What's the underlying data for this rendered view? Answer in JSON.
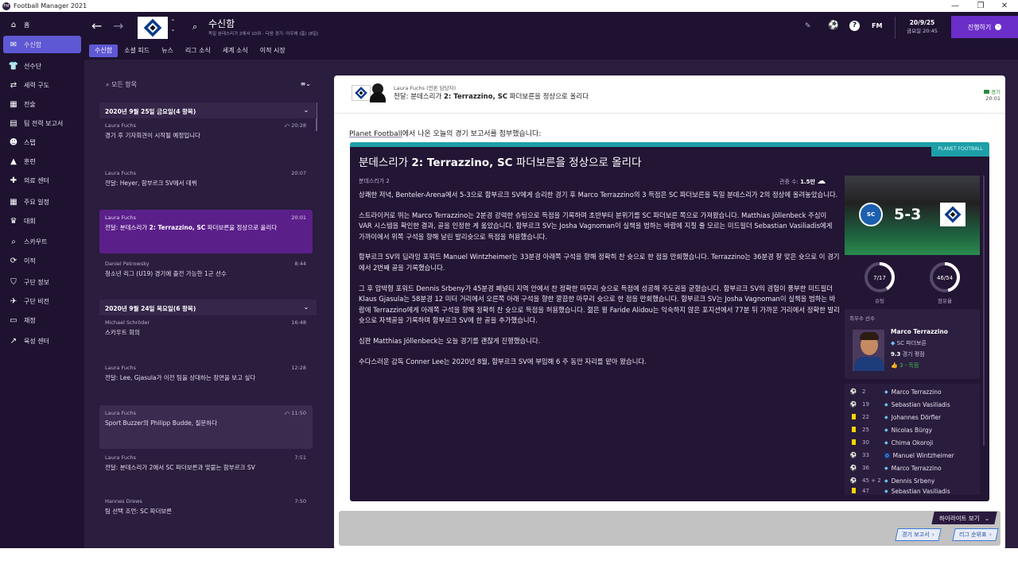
{
  "window": {
    "title": "Football Manager 2021",
    "minimize": "—",
    "restore": "❐",
    "close": "✕"
  },
  "sidebar": {
    "items": [
      {
        "label": "홈",
        "icon": "home-icon",
        "glyph": "⌂"
      },
      {
        "label": "수신함",
        "icon": "inbox-icon",
        "glyph": "✉",
        "active": true
      },
      {
        "label": "선수단",
        "icon": "squad-icon",
        "glyph": "👕"
      },
      {
        "label": "세력 구도",
        "icon": "dynamics-icon",
        "glyph": "⇄"
      },
      {
        "label": "전술",
        "icon": "tactics-icon",
        "glyph": "▦"
      },
      {
        "label": "팀 전력 보고서",
        "icon": "report-icon",
        "glyph": "▤"
      },
      {
        "label": "스탭",
        "icon": "staff-icon",
        "glyph": "☻"
      },
      {
        "label": "훈련",
        "icon": "training-icon",
        "glyph": "▲"
      },
      {
        "label": "의료 센터",
        "icon": "medical-icon",
        "glyph": "✚"
      },
      {
        "label": "주요 일정",
        "icon": "calendar-icon",
        "glyph": "▦"
      },
      {
        "label": "대회",
        "icon": "trophy-icon",
        "glyph": "♛"
      },
      {
        "label": "스카우트",
        "icon": "scout-icon",
        "glyph": "⌕"
      },
      {
        "label": "이적",
        "icon": "transfer-icon",
        "glyph": "⟳"
      },
      {
        "label": "구단 정보",
        "icon": "club-info-icon",
        "glyph": "⛉"
      },
      {
        "label": "구단 비전",
        "icon": "vision-icon",
        "glyph": "✈"
      },
      {
        "label": "재정",
        "icon": "finance-icon",
        "glyph": "▭"
      },
      {
        "label": "육성 센터",
        "icon": "development-icon",
        "glyph": "↗"
      }
    ]
  },
  "topbar": {
    "title": "수신함",
    "subtitle": "독일 분데스리가 2에서 10위 - 다음 경기: 아우에 (홈) (8일)",
    "date": "20/9/25",
    "datetime": "금요일 20:45",
    "fm_label": "FM",
    "continue_label": "진행하기",
    "help_glyph": "?"
  },
  "tabs": [
    "수신함",
    "소셜 피드",
    "뉴스",
    "리그 소식",
    "세계 소식",
    "이적 시장"
  ],
  "inbox": {
    "search_placeholder": "모든 항목",
    "groups": [
      {
        "header": "2020년 9월 25일 금요일(4 항목)"
      },
      {
        "header": "2020년 9월 24일 목요일(6 항목)"
      }
    ],
    "messages": [
      {
        "sender": "Laura Fuchs",
        "time": "20:28",
        "subject": "경기 후 기자회견이 시작될 예정입니다"
      },
      {
        "sender": "Laura Fuchs",
        "time": "20:07",
        "subject": "전달: Heyer, 함부르크 SV에서 데뷔"
      },
      {
        "sender": "Laura Fuchs",
        "time": "20:01",
        "subject_pre": "전달: 분데스리가 ",
        "subject_bold": "2: Terrazzino, SC",
        "subject_post": " 파더보른을 정상으로 올리다"
      },
      {
        "sender": "Daniel Petrowsky",
        "time": "8:44",
        "subject": "청소년 리그 (U19) 경기에 출전 가능한 1군 선수"
      },
      {
        "sender": "Michael Schröder",
        "time": "16:48",
        "subject": "스카우트 회의"
      },
      {
        "sender": "Laura Fuchs",
        "time": "12:28",
        "subject": "전달: Lee, Gjasula가 이전 팀을 상대하는 장면을 보고 싶다"
      },
      {
        "sender": "Laura Fuchs",
        "time": "11:50",
        "subject": "Sport Buzzer의 Philipp Budde, 질문하다"
      },
      {
        "sender": "Laura Fuchs",
        "time": "7:51",
        "subject": "전달: 분데스리가 2에서 SC 파더보른과 맞붙는 함부르크 SV"
      },
      {
        "sender": "Hannes Drews",
        "time": "7:50",
        "subject": "팀 선택 조언: SC 파더보른"
      }
    ]
  },
  "detail": {
    "from": "Laura Fuchs (언론 담당자)",
    "subject_pre": "전달: 분데스리가 ",
    "subject_bold": "2: Terrazzino, SC",
    "subject_post": " 파더보른을 정상으로 올리다",
    "tag": "경기",
    "time": "20:01",
    "intro_link": "Planet Football",
    "intro_rest": "에서 나온 오늘의 경기 보고서를 첨부했습니다:",
    "article": {
      "badge": "PLANET FOOTBALL",
      "title_pre": "분데스리가 ",
      "title_bold": "2: Terrazzino, SC",
      "title_post": " 파더보른을 정상으로 올리다",
      "competition": "분데스리가 2",
      "attendance_label": "관중 수:",
      "attendance_value": "1.5만",
      "p1": "상쾌한 저녁, Benteler-Arena에서 5-3으로 함부르크 SV에게 승리한 경기 후 Marco Terrazzino의 3 득점은 SC 파더보른을 독일 분데스리가 2의 정상에 올려놓았습니다.",
      "p2": "스트라이커로 뛰는 Marco Terrazzino는 2분경 강력한 슈팅으로 득점을 기록하며 초반부터 분위기를 SC 파더보른 쪽으로 가져왔습니다. Matthias Jöllenbeck 주심이 VAR 시스템을 확인한 결과, 골을 인정한 게 옳았습니다. 함부르크 SV는 Josha Vagnoman이 실책을 범하는 바람에 지칠 줄 모르는 미드필더 Sebastian Vasiliadis에게 가까이에서 위쪽 구석을 향해 날린 발리슛으로 득점을 허용했습니다.",
      "p3": "함부르크 SV의 딥라잉 포워드 Manuel Wintzheimer는 33분경 아래쪽 구석을 향해 정확히 찬 슛으로 한 점을 만회했습니다. Terrazzino는 36분경 잘 맞은 슛으로 이 경기에서 2번째 골을 기록했습니다.",
      "p4": "그 후 압박형 포워드 Dennis Srbeny가 45분경 페널티 지역 안에서 찬 정확한 마무리 슛으로 득점에 성공해 주도권을 굳혔습니다. 함부르크 SV의 경험이 풍부한 미드필더 Klaus Gjasula는 58분경 12 미터 거리에서 오른쪽 아래 구석을 향한 깔끔한 마무리 슛으로 한 점을 만회했습니다. 함부르크 SV는 Josha Vagnoman이 실책을 범하는 바람에 Terrazzino에게 아래쪽 구석을 향해 정확히 찬 슛으로 득점을 허용했습니다. 젊은 윙 Faride Alidou는 익숙하지 않은 포지션에서 77분 뒤 가까운 거리에서 정확한 발리슛으로 자책골을 기록하며 함부르크 SV에 한 골을 추가했습니다.",
      "p5": "심판 Matthias Jöllenbeck는 오늘 경기를 괜찮게 진행했습니다.",
      "p6": "수다스러운 감독 Conner Lee는 2020년 8월, 함부르크 SV에 부임해 6 주 동안 자리를 맡아 왔습니다."
    },
    "match": {
      "home_score": 5,
      "away_score": 3,
      "score_text": "5-3",
      "home_crest_text": "SC",
      "shots_value": "7/17",
      "shots_label": "슈팅",
      "shots_fraction": 0.41,
      "possession_value": "46/54",
      "possession_label": "점유율",
      "possession_fraction": 0.46,
      "motm_label": "최우수 선수",
      "motm_name": "Marco Terrazzino",
      "motm_club": "SC 파더보른",
      "motm_rating": "9.3",
      "motm_rating_label": "경기 평점",
      "motm_goals": "3 - 득점"
    },
    "events": [
      {
        "min": "2",
        "type": "goal",
        "player": "Marco Terrazzino"
      },
      {
        "min": "19",
        "type": "goal",
        "player": "Sebastian Vasiliadis"
      },
      {
        "min": "22",
        "type": "yellow",
        "player": "Johannes Dörfler"
      },
      {
        "min": "25",
        "type": "yellow",
        "player": "Nicolas Bürgy"
      },
      {
        "min": "30",
        "type": "yellow",
        "player": "Chima Okoroji"
      },
      {
        "min": "33",
        "type": "goal",
        "player": "Manuel Wintzheimer",
        "away": true
      },
      {
        "min": "36",
        "type": "goal",
        "player": "Marco Terrazzino"
      },
      {
        "min": "45 + 2",
        "type": "goal",
        "player": "Dennis Srbeny"
      },
      {
        "min": "47",
        "type": "yellow",
        "player": "Sebastian Vasiliadis"
      }
    ],
    "highlights_label": "하이라이트 보기",
    "report_button": "경기 보고서",
    "table_button": "리그 순위표"
  },
  "colors": {
    "accent": "#5f58d4",
    "selected_msg": "#5b1f8a",
    "planet": "#1d9fa8",
    "continue": "#6b2ec9",
    "highlight_btn": "#2a1a3e",
    "yellow_card": "#ffd400",
    "goal_green": "#3cc24a",
    "bg_dark": "#1e1230",
    "bg_mid": "#2b1d3d"
  }
}
